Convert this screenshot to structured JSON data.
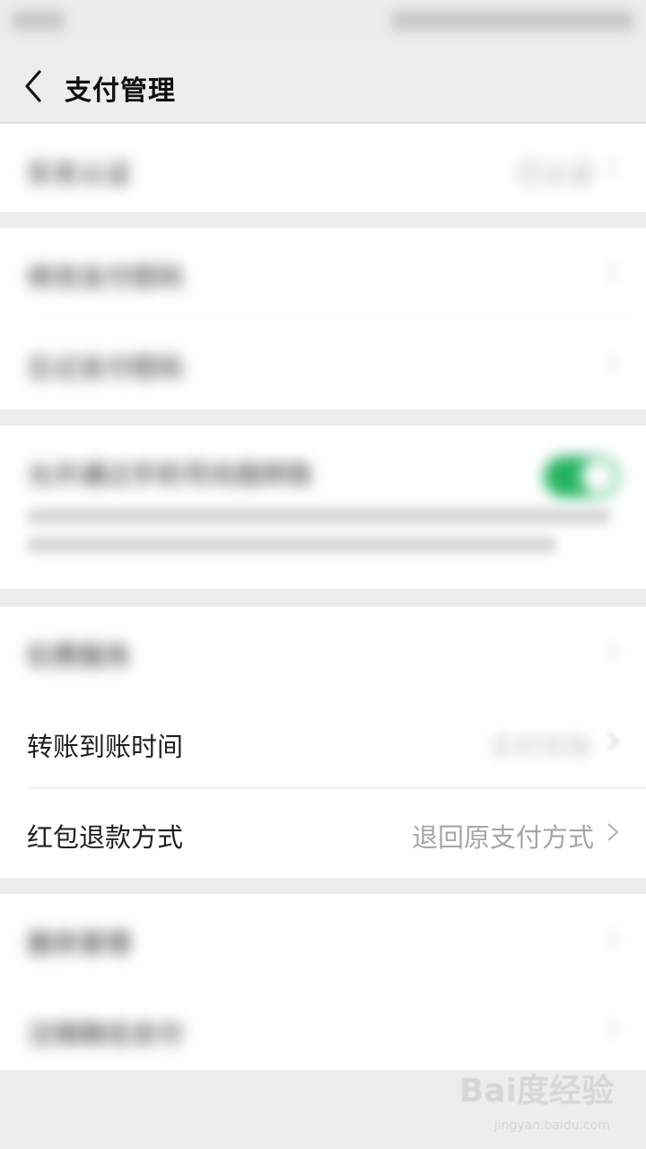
{
  "nav": {
    "title": "支付管理"
  },
  "rows": [
    {
      "label": "实名认证",
      "value": "已认证"
    },
    {
      "label": "修改支付密码"
    },
    {
      "label": "忘记支付密码"
    },
    {
      "label": "允许通过手机号向我转账",
      "toggle": "on"
    },
    {
      "label": "扣费服务"
    },
    {
      "label": "转账到账时间"
    },
    {
      "label": "红包退款方式",
      "value": "退回原支付方式"
    },
    {
      "label": "服务管理"
    },
    {
      "label": "注销微信支付"
    }
  ],
  "watermark": {
    "brand": "Bai度经验",
    "url": "jingyan.baidu.com"
  },
  "colors": {
    "toggle_on": "#22b35e",
    "background": "#ededed",
    "text": "#1f1f1f",
    "secondary": "#a6a6a6"
  },
  "icons": {
    "back": "chevron-left-icon",
    "chevron": "chevron-right-icon"
  }
}
